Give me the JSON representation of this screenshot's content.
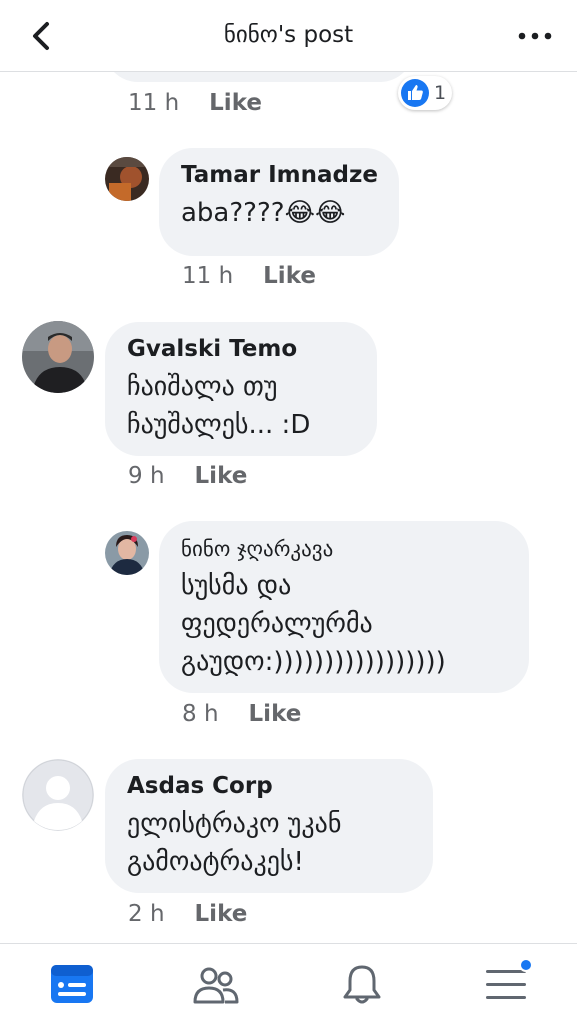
{
  "header": {
    "title": "ნინო's post",
    "back_icon": "chevron-left-icon",
    "more_icon": "more-dots-icon"
  },
  "previous_comment": {
    "time": "11 h",
    "like_label": "Like",
    "reaction_count": "1",
    "reaction_icon": "thumbs-up-icon"
  },
  "comments": [
    {
      "name": "Tamar Imnadze",
      "text": "aba????😂😂",
      "time": "11 h",
      "like_label": "Like"
    },
    {
      "name": "Gvalski Temo",
      "text": "ჩაიშალა  თუ\nჩაუშალეს... :D",
      "time": "9 h",
      "like_label": "Like"
    },
    {
      "name": "ნინო ჯღარკავა",
      "text": "სუსმა და\nფედერალურმა\nგაუდო:)))))))))))))))))",
      "time": "8 h",
      "like_label": "Like"
    },
    {
      "name": "Asdas Corp",
      "text": "ელისტრაკო უკან\nგამოატრაკეს!",
      "time": "2 h",
      "like_label": "Like"
    }
  ],
  "bottom_nav": [
    {
      "icon": "news-feed-icon",
      "active": true
    },
    {
      "icon": "friends-icon",
      "active": false
    },
    {
      "icon": "notifications-bell-icon",
      "active": false
    },
    {
      "icon": "menu-icon",
      "active": false,
      "badge": true
    }
  ],
  "colors": {
    "accent": "#1877f2",
    "bubble": "#f0f2f5",
    "muted": "#65676b"
  }
}
